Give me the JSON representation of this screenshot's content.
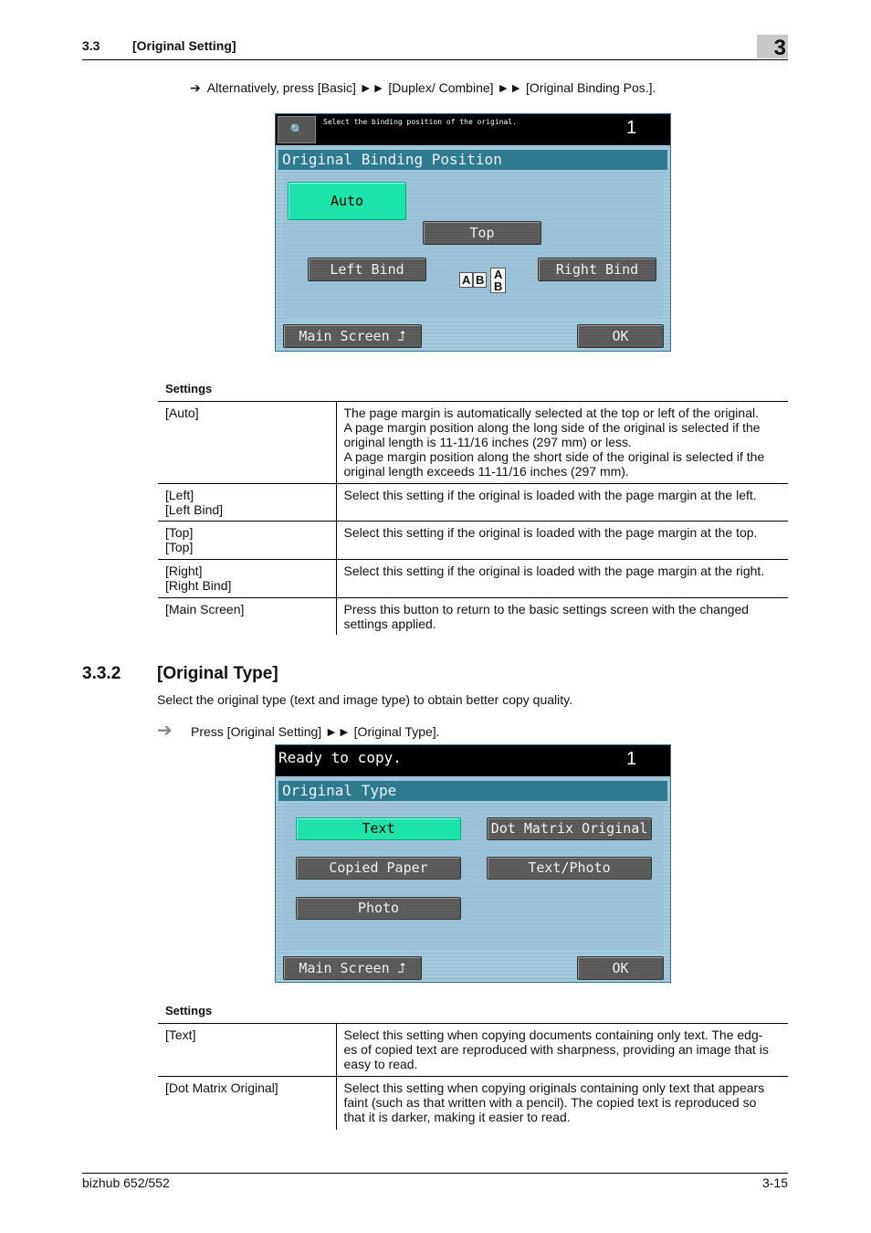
{
  "header": {
    "section_num": "3.3",
    "section_title": "[Original Setting]",
    "chapter": "3"
  },
  "intro_step": {
    "arrow": "➔",
    "text": "Alternatively, press [Basic] ►► [Duplex/ Combine] ►► [Original Binding Pos.]."
  },
  "screen1": {
    "message": "Select the binding position of the original.",
    "count": "1",
    "title": "Original Binding Position",
    "buttons": {
      "auto": "Auto",
      "top": "Top",
      "left": "Left Bind",
      "right": "Right Bind",
      "main": "Main Screen",
      "ok": "OK"
    },
    "selected": "Auto",
    "colors": {
      "selected": "#1de4a8",
      "title": "#2e7a8e"
    }
  },
  "settings1": {
    "label": "Settings",
    "rows": [
      [
        "[Auto]",
        "The page margin is automatically selected at the top or left of the original.\nA page margin position along the long side of the original is selected if the original length is 11-11/16 inches (297 mm) or less.\nA page margin position along the short side of the original is selected if the original length exceeds 11-11/16 inches (297 mm)."
      ],
      [
        "[Left]\n[Left Bind]",
        "Select this setting if the original is loaded with the page margin at the left."
      ],
      [
        "[Top]\n[Top]",
        "Select this setting if the original is loaded with the page margin at the top."
      ],
      [
        "[Right]\n[Right Bind]",
        "Select this setting if the original is loaded with the page margin at the right."
      ],
      [
        "[Main Screen]",
        "Press this button to return to the basic settings screen with the changed settings applied."
      ]
    ]
  },
  "section": {
    "num": "3.3.2",
    "title": "[Original Type]",
    "desc": "Select the original type (text and image type) to obtain better copy quality.",
    "step": "Press [Original Setting] ►► [Original Type]."
  },
  "screen2": {
    "message": "Ready to copy.",
    "count": "1",
    "title": "Original Type",
    "buttons": {
      "text": "Text",
      "dot": "Dot Matrix Original",
      "copied": "Copied Paper",
      "textphoto": "Text/Photo",
      "photo": "Photo",
      "main": "Main Screen",
      "ok": "OK"
    },
    "selected": "Text"
  },
  "settings2": {
    "label": "Settings",
    "rows": [
      [
        "[Text]",
        "Select this setting when copying documents containing only text. The edg-\nes of copied text are reproduced with sharpness, providing an image that is easy to read."
      ],
      [
        "[Dot Matrix Original]",
        "Select this setting when copying originals containing only text that appears faint (such as that written with a pencil). The copied text is reproduced so that it is darker, making it easier to read."
      ]
    ]
  },
  "footer": {
    "product": "bizhub 652/552",
    "page": "3-15"
  }
}
